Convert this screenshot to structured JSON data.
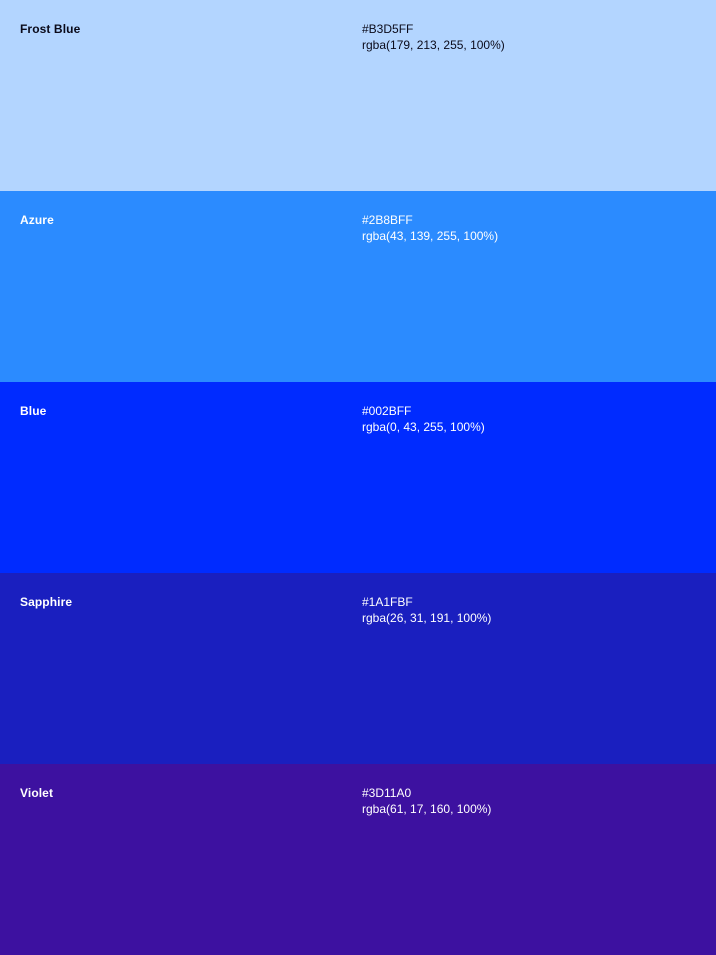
{
  "swatches": [
    {
      "name": "Frost Blue",
      "hex": "#B3D5FF",
      "rgba": "rgba(179, 213, 255, 100%)",
      "color": "#B3D5FF",
      "text_color": "#0A0A1A"
    },
    {
      "name": "Azure",
      "hex": "#2B8BFF",
      "rgba": "rgba(43, 139, 255, 100%)",
      "color": "#2B8BFF",
      "text_color": "#FFFFFF"
    },
    {
      "name": "Blue",
      "hex": "#002BFF",
      "rgba": "rgba(0, 43, 255, 100%)",
      "color": "#002BFF",
      "text_color": "#FFFFFF"
    },
    {
      "name": "Sapphire",
      "hex": "#1A1FBF",
      "rgba": "rgba(26, 31, 191, 100%)",
      "color": "#1A1FBF",
      "text_color": "#FFFFFF"
    },
    {
      "name": "Violet",
      "hex": "#3D11A0",
      "rgba": "rgba(61, 17, 160, 100%)",
      "color": "#3D11A0",
      "text_color": "#FFFFFF"
    }
  ]
}
